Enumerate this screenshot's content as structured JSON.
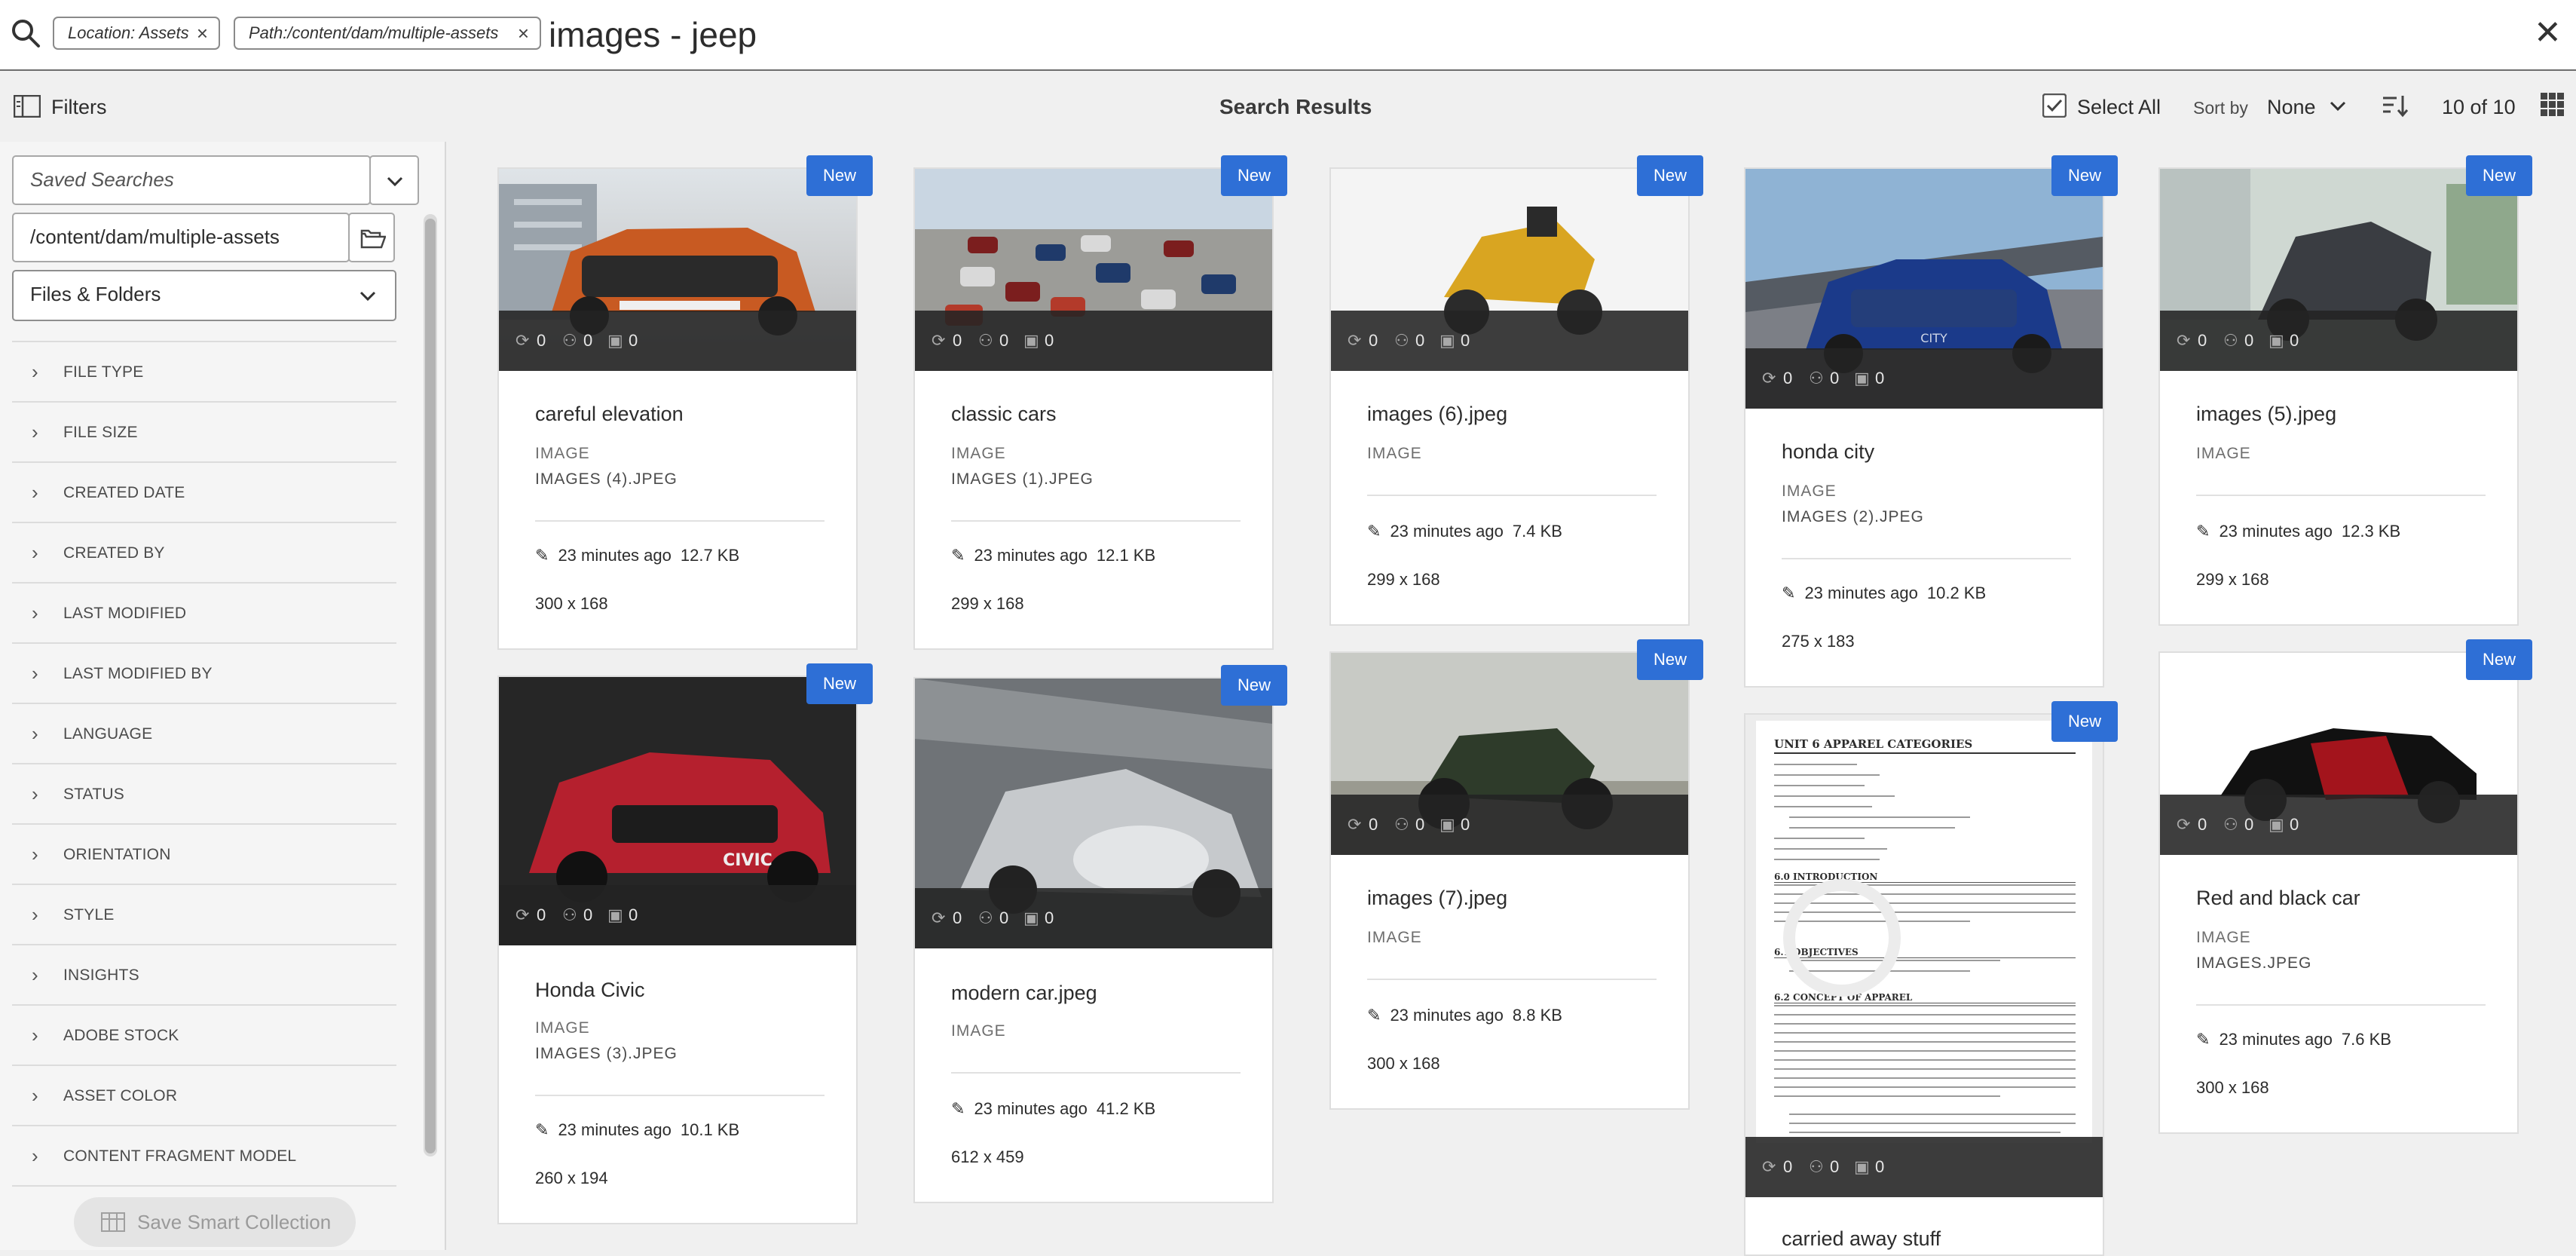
{
  "search": {
    "tags": [
      {
        "label": "Location: Assets"
      },
      {
        "label": "Path:/content/dam/multiple-assets"
      }
    ],
    "query": "images - jeep"
  },
  "actionbar": {
    "filters_label": "Filters",
    "title": "Search Results",
    "select_all_label": "Select All",
    "sort_by_label": "Sort by",
    "sort_value": "None",
    "count_label": "10 of 10"
  },
  "leftrail": {
    "saved_searches_placeholder": "Saved Searches",
    "path_value": "/content/dam/multiple-assets",
    "type_select_value": "Files & Folders",
    "facets": [
      "FILE TYPE",
      "FILE SIZE",
      "CREATED DATE",
      "CREATED BY",
      "LAST MODIFIED",
      "LAST MODIFIED BY",
      "LANGUAGE",
      "STATUS",
      "ORIENTATION",
      "STYLE",
      "INSIGHTS",
      "ADOBE STOCK",
      "ASSET COLOR",
      "CONTENT FRAGMENT MODEL"
    ],
    "save_collection_label": "Save Smart Collection"
  },
  "cards": [
    {
      "title": "careful elevation",
      "type": "IMAGE",
      "filename": "IMAGES (4).JPEG",
      "modified": "23 minutes ago",
      "size": "12.7 KB",
      "dimensions": "300 x 168",
      "badge": "New",
      "stats": [
        "0",
        "0",
        "0"
      ]
    },
    {
      "title": "classic cars",
      "type": "IMAGE",
      "filename": "IMAGES (1).JPEG",
      "modified": "23 minutes ago",
      "size": "12.1 KB",
      "dimensions": "299 x 168",
      "badge": "New",
      "stats": [
        "0",
        "0",
        "0"
      ]
    },
    {
      "title": "images (6).jpeg",
      "type": "IMAGE",
      "filename": "",
      "modified": "23 minutes ago",
      "size": "7.4 KB",
      "dimensions": "299 x 168",
      "badge": "New",
      "stats": [
        "0",
        "0",
        "0"
      ]
    },
    {
      "title": "honda city",
      "type": "IMAGE",
      "filename": "IMAGES (2).JPEG",
      "modified": "23 minutes ago",
      "size": "10.2 KB",
      "dimensions": "275 x 183",
      "badge": "New",
      "stats": [
        "0",
        "0",
        "0"
      ]
    },
    {
      "title": "images (5).jpeg",
      "type": "IMAGE",
      "filename": "",
      "modified": "23 minutes ago",
      "size": "12.3 KB",
      "dimensions": "299 x 168",
      "badge": "New",
      "stats": [
        "0",
        "0",
        "0"
      ]
    },
    {
      "title": "Honda Civic",
      "type": "IMAGE",
      "filename": "IMAGES (3).JPEG",
      "modified": "23 minutes ago",
      "size": "10.1 KB",
      "dimensions": "260 x 194",
      "badge": "New",
      "stats": [
        "0",
        "0",
        "0"
      ],
      "thumb_text": "CIVIC"
    },
    {
      "title": "modern car.jpeg",
      "type": "IMAGE",
      "filename": "",
      "modified": "23 minutes ago",
      "size": "41.2 KB",
      "dimensions": "612 x 459",
      "badge": "New",
      "stats": [
        "0",
        "0",
        "0"
      ]
    },
    {
      "title": "images (7).jpeg",
      "type": "IMAGE",
      "filename": "",
      "modified": "23 minutes ago",
      "size": "8.8 KB",
      "dimensions": "300 x 168",
      "badge": "New",
      "stats": [
        "0",
        "0",
        "0"
      ]
    },
    {
      "title": "carried away stuff",
      "type": "",
      "filename": "",
      "modified": "",
      "size": "",
      "dimensions": "",
      "badge": "New",
      "stats": [
        "0",
        "0",
        "0"
      ],
      "doc_heading": "UNIT 6    APPAREL CATEGORIES",
      "doc_sections": [
        "6.0   INTRODUCTION",
        "6.1   OBJECTIVES",
        "6.2   CONCEPT OF APPAREL"
      ]
    },
    {
      "title": "Red and black car",
      "type": "IMAGE",
      "filename": "IMAGES.JPEG",
      "modified": "23 minutes ago",
      "size": "7.6 KB",
      "dimensions": "300 x 168",
      "badge": "New",
      "stats": [
        "0",
        "0",
        "0"
      ]
    }
  ],
  "colors": {
    "accent": "#2e6fd6",
    "overlay": "#232323"
  }
}
